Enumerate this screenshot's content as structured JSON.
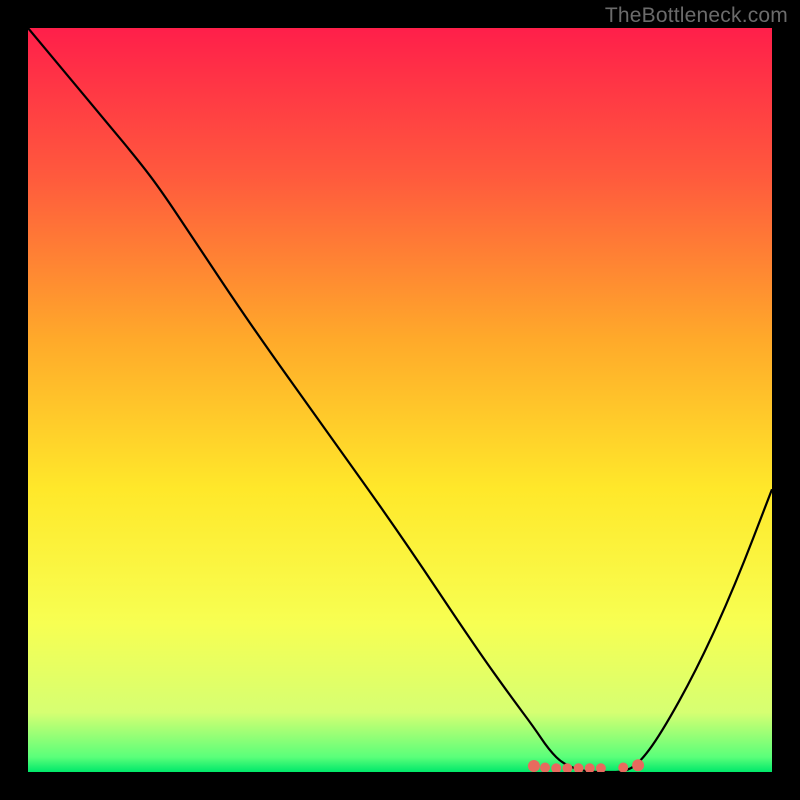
{
  "watermark": "TheBottleneck.com",
  "chart_data": {
    "type": "line",
    "title": "",
    "xlabel": "",
    "ylabel": "",
    "xlim": [
      0,
      100
    ],
    "ylim": [
      0,
      100
    ],
    "grid": false,
    "series": [
      {
        "name": "curve",
        "color": "#000000",
        "x": [
          0,
          5,
          10,
          15,
          18,
          22,
          30,
          40,
          50,
          60,
          65,
          68,
          70,
          72,
          75,
          78,
          80,
          82,
          85,
          90,
          95,
          100
        ],
        "y": [
          100,
          94,
          88,
          82,
          78,
          72,
          60,
          46,
          32,
          17,
          10,
          6,
          3,
          1,
          0,
          0,
          0,
          1,
          5,
          14,
          25,
          38
        ]
      }
    ],
    "background_gradient": {
      "type": "linear-vertical",
      "stops": [
        {
          "pos": 0.0,
          "color": "#ff1f4a"
        },
        {
          "pos": 0.2,
          "color": "#ff5a3d"
        },
        {
          "pos": 0.42,
          "color": "#ffaa2a"
        },
        {
          "pos": 0.62,
          "color": "#ffe82a"
        },
        {
          "pos": 0.8,
          "color": "#f7ff52"
        },
        {
          "pos": 0.92,
          "color": "#d6ff72"
        },
        {
          "pos": 0.98,
          "color": "#5aff7a"
        },
        {
          "pos": 1.0,
          "color": "#00e86a"
        }
      ]
    },
    "markers": {
      "color": "#e86a5e",
      "x": [
        68,
        69.5,
        71,
        72.5,
        74,
        75.5,
        77,
        80,
        82
      ],
      "y": [
        0.8,
        0.6,
        0.5,
        0.5,
        0.5,
        0.5,
        0.5,
        0.6,
        0.9
      ],
      "radius": [
        6,
        5,
        5,
        5,
        5,
        5,
        5,
        5,
        6
      ]
    }
  }
}
